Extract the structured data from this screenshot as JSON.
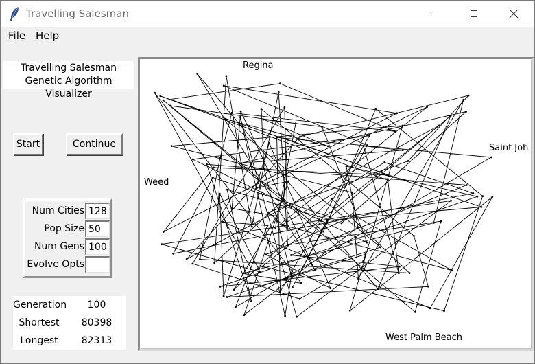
{
  "window": {
    "title": "Travelling Salesman"
  },
  "menu": {
    "file": "File",
    "help": "Help"
  },
  "app": {
    "title_line1": "Travelling Salesman",
    "title_line2": "Genetic Algorithm Visualizer"
  },
  "buttons": {
    "start": "Start",
    "continue": "Continue"
  },
  "options": [
    {
      "label": "Num Cities",
      "value": "128"
    },
    {
      "label": "Pop Size",
      "value": "50"
    },
    {
      "label": "Num Gens",
      "value": "100"
    },
    {
      "label": "Evolve Opts",
      "value": ""
    }
  ],
  "stats": [
    {
      "label": "Generation",
      "value": "100"
    },
    {
      "label": "Shortest",
      "value": "80398"
    },
    {
      "label": "Longest",
      "value": "82313"
    }
  ],
  "map": {
    "city_labels": [
      "Regina",
      "Saint Joh",
      "Weed",
      "West Palm Beach"
    ]
  }
}
